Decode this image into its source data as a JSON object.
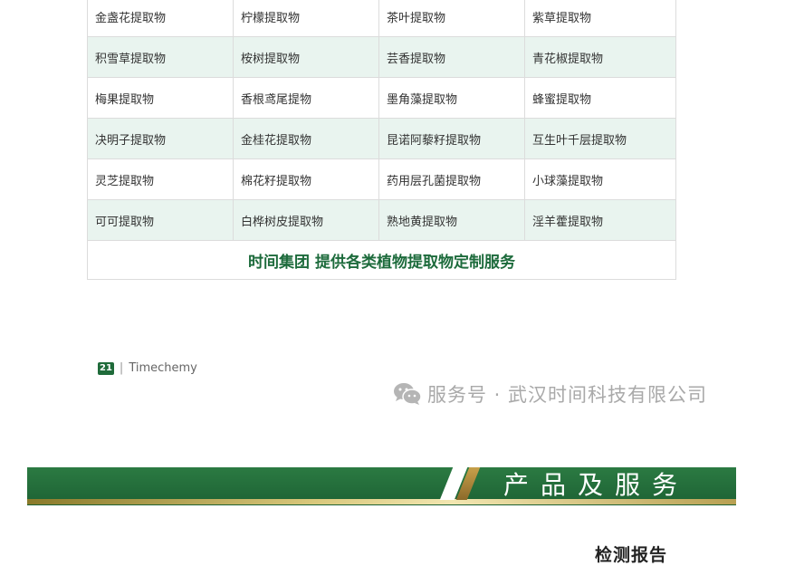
{
  "extracts_table": {
    "rows": [
      [
        "金盏花提取物",
        "柠檬提取物",
        "茶叶提取物",
        "紫草提取物"
      ],
      [
        "积雪草提取物",
        "桉树提取物",
        "芸香提取物",
        "青花椒提取物"
      ],
      [
        "梅果提取物",
        "香根鸢尾提物",
        "墨角藻提取物",
        "蜂蜜提取物"
      ],
      [
        "决明子提取物",
        "金桂花提取物",
        "昆诺阿藜籽提取物",
        "互生叶千层提取物"
      ],
      [
        "灵芝提取物",
        "棉花籽提取物",
        "药用层孔菌提取物",
        "小球藻提取物"
      ],
      [
        "可可提取物",
        "白桦树皮提取物",
        "熟地黄提取物",
        "淫羊藿提取物"
      ]
    ],
    "footer": "时间集团 提供各类植物提取物定制服务"
  },
  "page_footer": {
    "page_number": "21",
    "separator": "|",
    "brand": "Timechemy"
  },
  "watermark": {
    "icon": "wechat-icon",
    "text": "服务号 · 武汉时间科技有限公司"
  },
  "banner": {
    "title": "产品及服务"
  },
  "section": {
    "heading": "检测报告"
  },
  "colors": {
    "brand_green": "#1f6b3a",
    "row_shade": "#e9f4ef",
    "gold": "#c7a04a"
  }
}
